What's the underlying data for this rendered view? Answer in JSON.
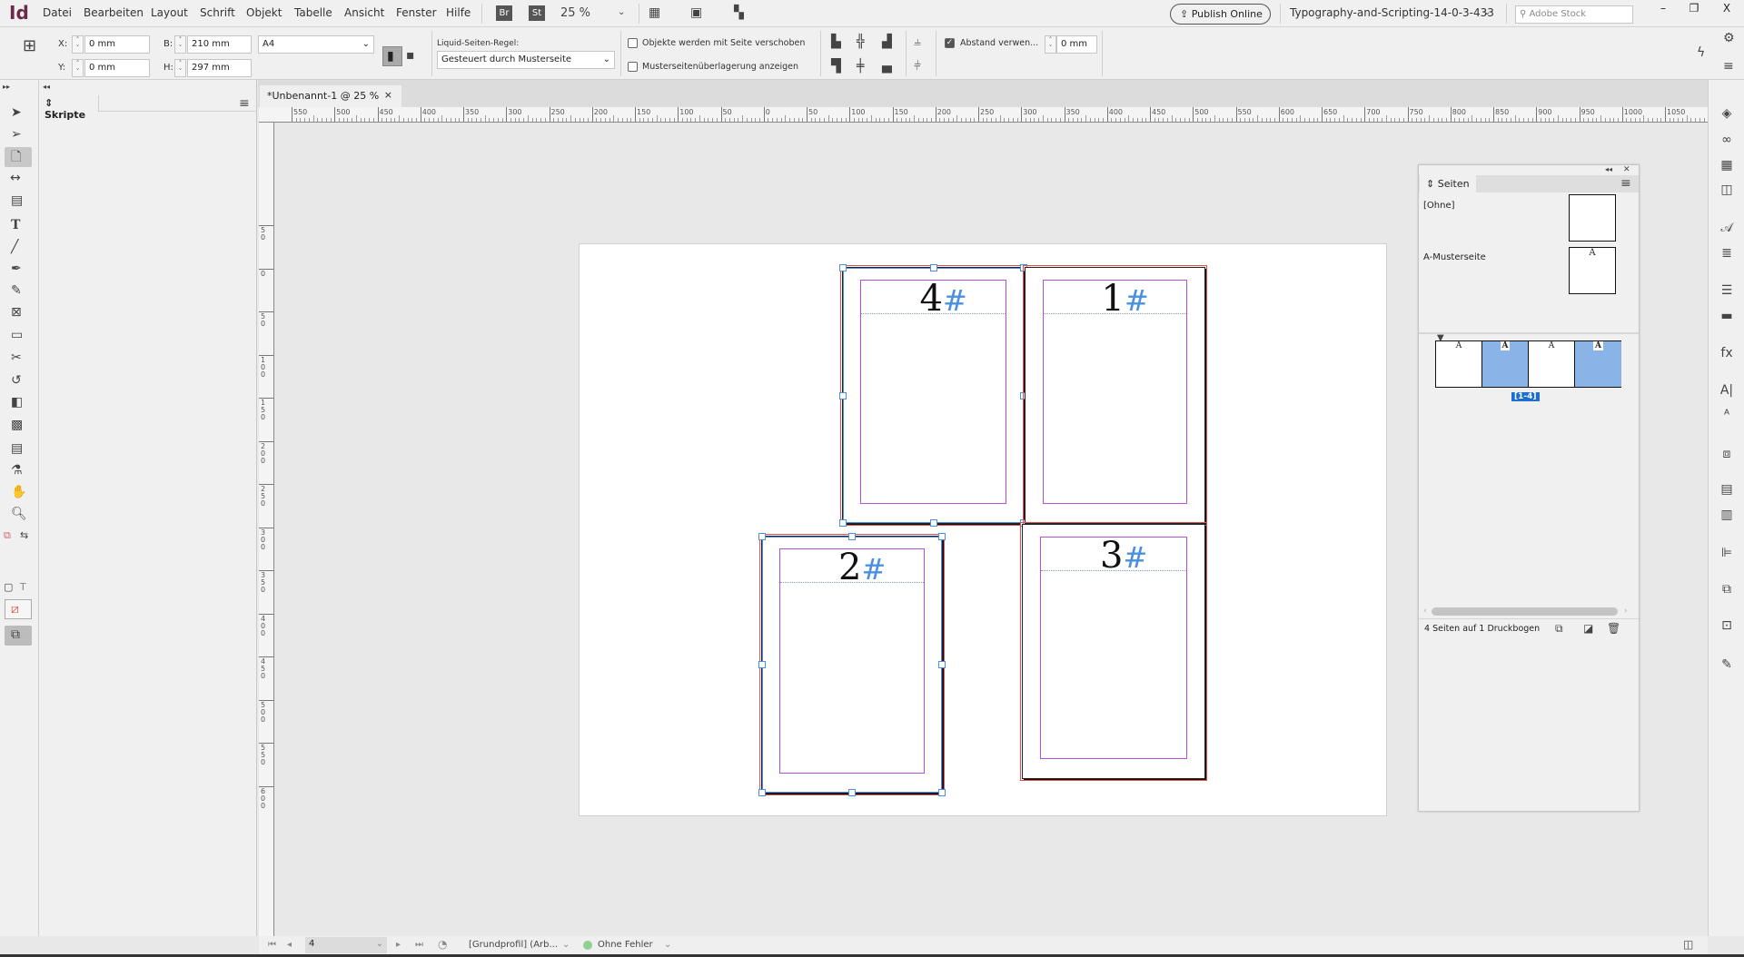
{
  "app": {
    "logo": "Id"
  },
  "menu": [
    "Datei",
    "Bearbeiten",
    "Layout",
    "Schrift",
    "Objekt",
    "Tabelle",
    "Ansicht",
    "Fenster",
    "Hilfe"
  ],
  "top": {
    "bridge": "Br",
    "stock": "St",
    "zoom": "25 %",
    "publish_label": "Publish Online",
    "doc_title": "Typography-and-Scripting-14-0-3-433",
    "search_placeholder": "Adobe Stock",
    "min": "–",
    "restore": "❐",
    "close": "X"
  },
  "control": {
    "x_label": "X:",
    "x_value": "0 mm",
    "y_label": "Y:",
    "y_value": "0 mm",
    "b_label": "B:",
    "b_value": "210 mm",
    "h_label": "H:",
    "h_value": "297 mm",
    "size_preset": "A4",
    "liquid_label": "Liquid-Seiten-Regel:",
    "liquid_value": "Gesteuert durch Musterseite",
    "cb_move_objects": "Objekte werden mit Seite verschoben",
    "cb_move_objects_checked": false,
    "cb_master_overlay": "Musterseitenüberlagerung anzeigen",
    "cb_master_overlay_checked": false,
    "spacing_label": "Abstand verwen...",
    "spacing_checked": true,
    "spacing_value": "0 mm"
  },
  "panels": {
    "skripte_title": "Skripte"
  },
  "document_tab": {
    "title": "*Unbenannt-1 @ 25 %",
    "close": "×"
  },
  "ruler": {
    "h_labels": [
      "550",
      "500",
      "450",
      "400",
      "350",
      "300",
      "250",
      "200",
      "150",
      "100",
      "50",
      "0",
      "50",
      "100",
      "150",
      "200",
      "250",
      "300",
      "350",
      "400",
      "450",
      "500",
      "550",
      "600",
      "650",
      "700",
      "750",
      "800",
      "850",
      "900",
      "950",
      "1000",
      "1050"
    ],
    "v_labels": [
      "50",
      "0",
      "50",
      "100",
      "150",
      "200",
      "250",
      "300",
      "350",
      "400",
      "450",
      "500",
      "550",
      "600"
    ]
  },
  "canvas_pages": [
    {
      "number": "4",
      "marker": "#",
      "selected": true
    },
    {
      "number": "1",
      "marker": "#",
      "selected": false
    },
    {
      "number": "2",
      "marker": "#",
      "selected": true
    },
    {
      "number": "3",
      "marker": "#",
      "selected": false
    }
  ],
  "colors": {
    "selection": "#4a8fe0",
    "margin": "#b44fd8",
    "bleed": "#e05050",
    "thumb_selected": "#8ab4e8",
    "spread_label_bg": "#1a6fd0"
  },
  "pages_panel": {
    "tab": "Seiten",
    "masters": [
      {
        "name": "[Ohne]",
        "thumb_letter": ""
      },
      {
        "name": "A-Musterseite",
        "thumb_letter": "A"
      }
    ],
    "spread_pages": [
      {
        "letter": "A",
        "selected": false
      },
      {
        "letter": "A",
        "selected": true
      },
      {
        "letter": "A",
        "selected": false
      },
      {
        "letter": "A",
        "selected": true
      }
    ],
    "spread_label": "[1-4]",
    "footer": "4 Seiten auf 1 Druckbogen"
  },
  "status": {
    "page": "4",
    "profile": "[Grundprofil] (Arb...",
    "preflight": "Ohne Fehler",
    "preflight_color": "#8fcf8f"
  }
}
